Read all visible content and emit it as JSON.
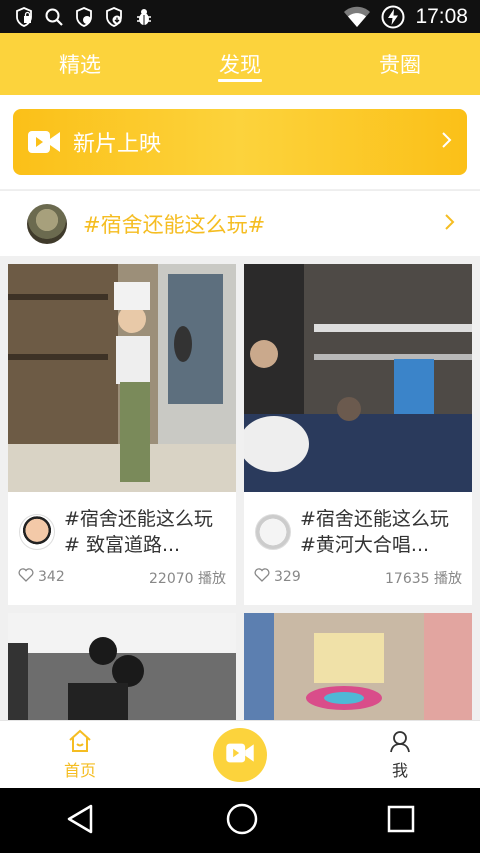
{
  "status_bar": {
    "time": "17:08",
    "icons": [
      "lock-app-icon",
      "search-icon",
      "shield-icon",
      "download-shield-icon",
      "bug-icon",
      "wifi-icon",
      "battery-charging-icon"
    ]
  },
  "top_tabs": [
    {
      "label": "精选",
      "active": false
    },
    {
      "label": "发现",
      "active": true
    },
    {
      "label": "贵圈",
      "active": false
    }
  ],
  "banner": {
    "label": "新片上映",
    "icon": "video-camera-icon"
  },
  "topic": {
    "label": "#宿舍还能这么玩#"
  },
  "cards": [
    {
      "title": "#宿舍还能这么玩# 致富道路...",
      "likes": "342",
      "plays": "22070 播放"
    },
    {
      "title": "#宿舍还能这么玩#黄河大合唱...",
      "likes": "329",
      "plays": "17635 播放"
    },
    {
      "title": "",
      "likes": "",
      "plays": ""
    },
    {
      "title": "",
      "likes": "",
      "plays": ""
    }
  ],
  "bottom_nav": {
    "home_label": "首页",
    "me_label": "我"
  },
  "colors": {
    "accent": "#fcd33c",
    "topic_text": "#f5bd22"
  }
}
